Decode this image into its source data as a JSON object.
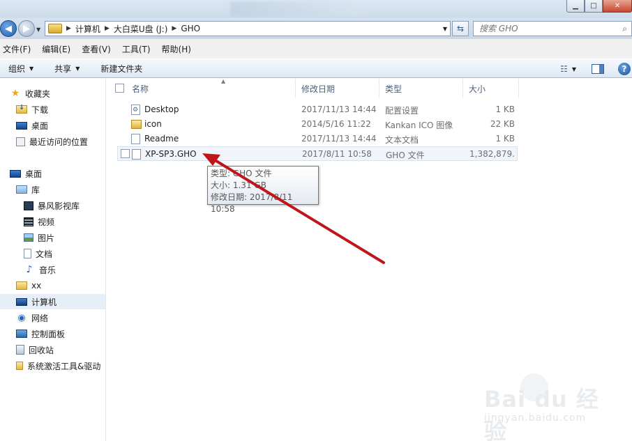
{
  "window": {
    "controls": {
      "minimize": "▁",
      "maximize": "□",
      "close": "✕"
    }
  },
  "address": {
    "breadcrumbs": [
      "计算机",
      "大白菜U盘 (J:)",
      "GHO"
    ]
  },
  "search": {
    "placeholder": "搜索 GHO"
  },
  "menu": [
    "文件(F)",
    "编辑(E)",
    "查看(V)",
    "工具(T)",
    "帮助(H)"
  ],
  "commands": {
    "organize": "组织",
    "share": "共享",
    "new_folder": "新建文件夹"
  },
  "sidebar": {
    "favorites": {
      "label": "收藏夹",
      "items": [
        "下载",
        "桌面",
        "最近访问的位置"
      ]
    },
    "desktop": "桌面",
    "library": {
      "label": "库",
      "items": [
        "暴风影视库",
        "视频",
        "图片",
        "文档",
        "音乐"
      ]
    },
    "user": "xx",
    "computer": "计算机",
    "network": "网络",
    "control_panel": "控制面板",
    "recycle_bin": "回收站",
    "tools": "系统激活工具&驱动"
  },
  "columns": {
    "name": "名称",
    "date": "修改日期",
    "type": "类型",
    "size": "大小"
  },
  "files": [
    {
      "name": "Desktop",
      "date": "2017/11/13 14:44",
      "type": "配置设置",
      "size": "1 KB",
      "icon": "config-file-icon"
    },
    {
      "name": "icon",
      "date": "2014/5/16 11:22",
      "type": "Kankan ICO 图像",
      "size": "22 KB",
      "icon": "folder-icon"
    },
    {
      "name": "Readme",
      "date": "2017/11/13 14:44",
      "type": "文本文档",
      "size": "1 KB",
      "icon": "text-file-icon"
    },
    {
      "name": "XP-SP3.GHO",
      "date": "2017/8/11 10:58",
      "type": "GHO 文件",
      "size": "1,382,879...",
      "icon": "gho-file-icon"
    }
  ],
  "tooltip": {
    "type_line": "类型: GHO 文件",
    "size_line": "大小: 1.31 GB",
    "date_line": "修改日期: 2017/8/11 10:58"
  },
  "watermark": {
    "logo": "Bai du 经验",
    "url": "jingyan.baidu.com"
  },
  "colors": {
    "annotation_arrow": "#c0161b",
    "selection": "#e6eef8"
  }
}
